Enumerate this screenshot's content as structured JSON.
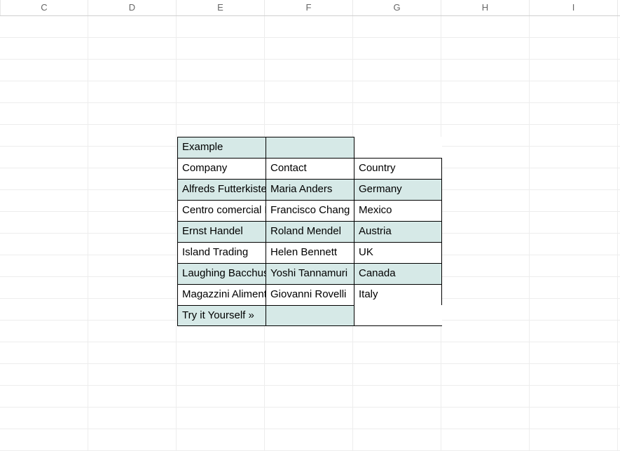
{
  "columns": [
    "C",
    "D",
    "E",
    "F",
    "G",
    "H",
    "I"
  ],
  "table": {
    "title": "Example",
    "headers": [
      "Company",
      "Contact",
      "Country"
    ],
    "rows": [
      [
        "Alfreds Futterkiste",
        "Maria Anders",
        "Germany"
      ],
      [
        "Centro comercial Moctezuma",
        "Francisco Chang",
        "Mexico"
      ],
      [
        "Ernst Handel",
        "Roland Mendel",
        "Austria"
      ],
      [
        "Island Trading",
        "Helen Bennett",
        "UK"
      ],
      [
        "Laughing Bacchus Winecellars",
        "Yoshi Tannamuri",
        "Canada"
      ],
      [
        "Magazzini Alimentari Riuniti",
        "Giovanni Rovelli",
        "Italy"
      ]
    ],
    "footer": "Try it Yourself »"
  },
  "colors": {
    "shaded": "#d6e9e7"
  }
}
